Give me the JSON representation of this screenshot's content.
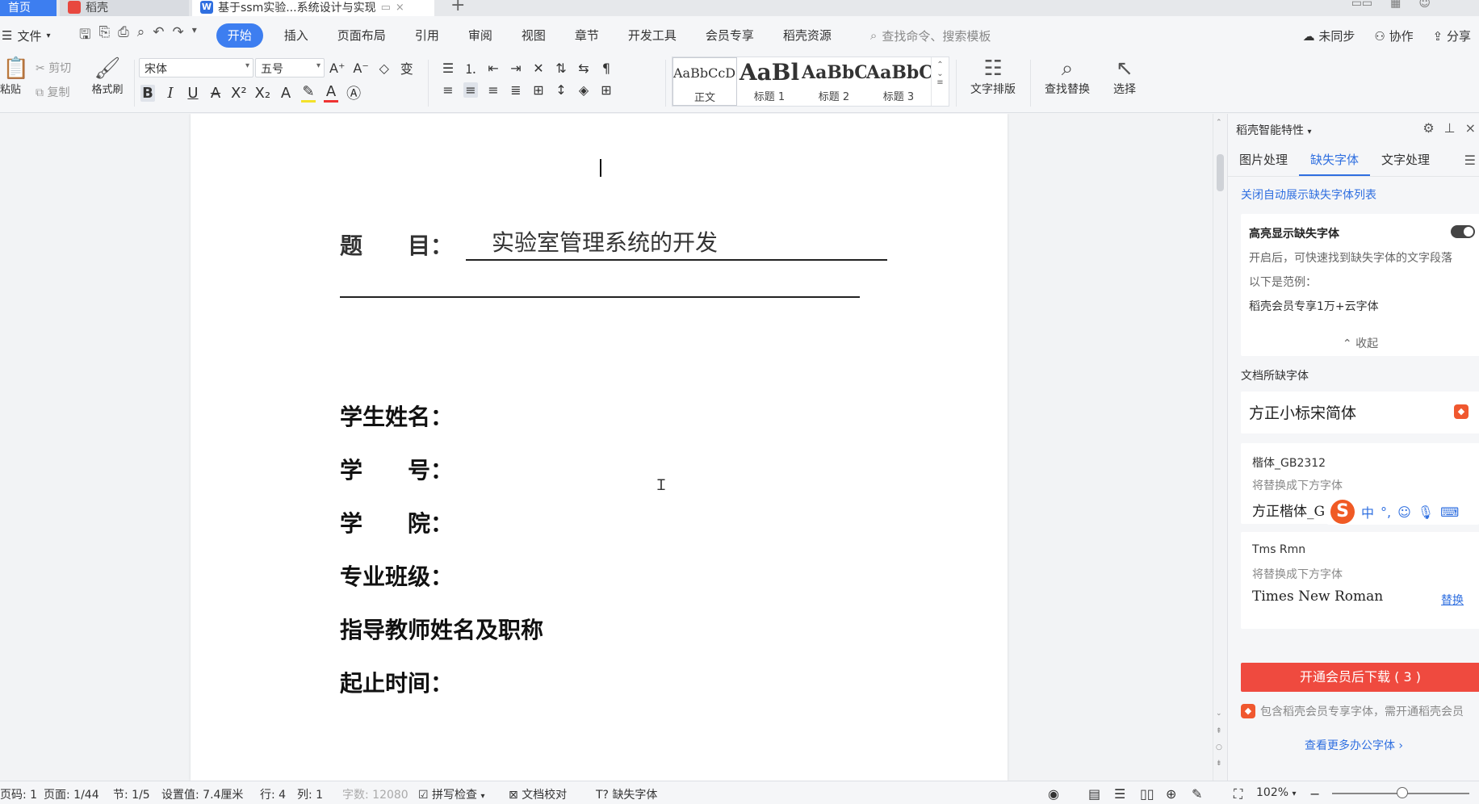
{
  "titlebar": {
    "tabs": [
      {
        "label": "首页"
      },
      {
        "label": "稻壳"
      },
      {
        "label": "基于ssm实验...系统设计与实现"
      }
    ],
    "add": "+",
    "close": "×"
  },
  "menubar": {
    "file": "文件",
    "tabs": [
      "开始",
      "插入",
      "页面布局",
      "引用",
      "审阅",
      "视图",
      "章节",
      "开发工具",
      "会员专享",
      "稻壳资源"
    ],
    "search_placeholder": "查找命令、搜索模板",
    "right": [
      "未同步",
      "协作",
      "分享"
    ]
  },
  "ribbon": {
    "paste": "粘贴",
    "cut": "剪切",
    "copy": "复制",
    "format_painter": "格式刷",
    "font_name": "宋体",
    "font_size": "五号",
    "styles": [
      {
        "sample": "AaBbCcDd",
        "name": "正文"
      },
      {
        "sample": "AaBl",
        "name": "标题 1"
      },
      {
        "sample": "AaBbC",
        "name": "标题 2"
      },
      {
        "sample": "AaBbC",
        "name": "标题 3"
      }
    ],
    "text_layout": "文字排版",
    "find_replace": "查找替换",
    "select": "选择"
  },
  "document": {
    "title_label": "题　　目：",
    "title_value": "实验室管理系统的开发",
    "fields": [
      "学生姓名：",
      "学　　号：",
      "学　　院：",
      "专业班级：",
      "指导教师姓名及职称",
      "起止时间："
    ]
  },
  "panel": {
    "header": "稻壳智能特性",
    "tabs": [
      "图片处理",
      "缺失字体",
      "文字处理"
    ],
    "close_auto_link": "关闭自动展示缺失字体列表",
    "highlight": {
      "title": "高亮显示缺失字体",
      "desc": "开启后，可快速找到缺失字体的文字段落",
      "example_label": "以下是范例：",
      "example_text": "稻壳会员专享1万+云字体",
      "collapse": "收起"
    },
    "missing_title": "文档所缺字体",
    "missing_fonts": [
      {
        "name": "方正小标宋简体"
      },
      {
        "name": "楷体_GB2312",
        "hint": "将替换成下方字体",
        "replacement": "方正楷体_G"
      },
      {
        "name": "Tms Rmn",
        "hint": "将替换成下方字体",
        "replacement": "Times New Roman",
        "action": "替换"
      }
    ],
    "download_button": "开通会员后下载 ( 3 )",
    "vip_note": "包含稻壳会员专享字体，需开通稻壳会员",
    "more_link": "查看更多办公字体 ›",
    "ime": {
      "mode": "中",
      "punct": "°,"
    }
  },
  "statusbar": {
    "page_code": "页码: 1",
    "page": "页面: 1/44",
    "section": "节: 1/5",
    "setting": "设置值: 7.4厘米",
    "row": "行: 4",
    "col": "列: 1",
    "word_count": "字数: 12080",
    "spell_check": "拼写检查",
    "doc_proof": "文档校对",
    "missing_font": "缺失字体",
    "zoom": "102%"
  },
  "colors": {
    "accent": "#3d7ef0",
    "link": "#2f6fe0",
    "download": "#ef4a3f",
    "vip": "#f0582f"
  }
}
